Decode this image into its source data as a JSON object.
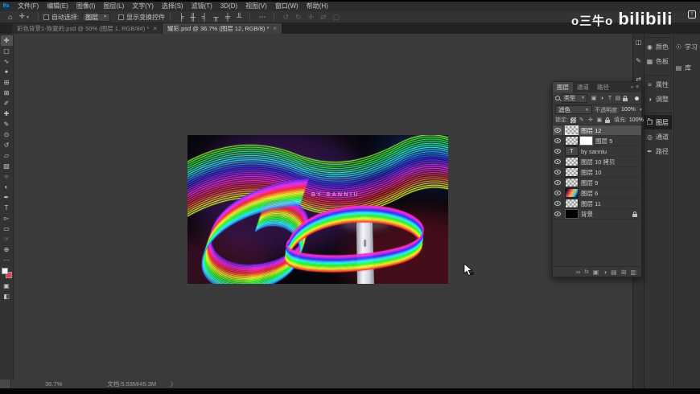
{
  "watermark": {
    "uploader": "o三牛o",
    "platform": "bilibili",
    "share_glyph": "↑"
  },
  "app": {
    "icon_label": "Ps"
  },
  "menu_bar": {
    "items": [
      "文件(F)",
      "编辑(E)",
      "图像(I)",
      "图层(L)",
      "文字(Y)",
      "选择(S)",
      "滤镜(T)",
      "3D(D)",
      "视图(V)",
      "窗口(W)",
      "帮助(H)"
    ]
  },
  "options_bar": {
    "home_glyph": "⌂",
    "move_glyph": "✛",
    "auto_select_label": "自动选择:",
    "auto_select_value": "图层",
    "show_transform_label": "显示变换控件",
    "align_icons": [
      {
        "name": "align-left-icon",
        "glyph": "╞"
      },
      {
        "name": "align-center-icon",
        "glyph": "╫"
      },
      {
        "name": "align-right-icon",
        "glyph": "╡"
      },
      {
        "name": "align-top-icon",
        "glyph": "╥"
      },
      {
        "name": "align-middle-icon",
        "glyph": "╪"
      },
      {
        "name": "align-bottom-icon",
        "glyph": "╨"
      }
    ],
    "more_glyph": "⋯",
    "threed_icons": [
      {
        "name": "3d-rotate-icon",
        "glyph": "↺"
      },
      {
        "name": "3d-roll-icon",
        "glyph": "↻"
      },
      {
        "name": "3d-drag-icon",
        "glyph": "✛"
      },
      {
        "name": "3d-slide-icon",
        "glyph": "⇄"
      },
      {
        "name": "3d-scale-icon",
        "glyph": "▢"
      }
    ]
  },
  "document_tabs": [
    {
      "title": "彩色背景1-恢复的.psd @ 50% (图层 1, RGB/8#) *",
      "close_glyph": "×",
      "active": false
    },
    {
      "title": "耀彩.psd @ 36.7% (图层 12, RGB/8) *",
      "close_glyph": "×",
      "active": true
    }
  ],
  "tools": [
    {
      "name": "move-tool",
      "glyph": "✛",
      "active": true
    },
    {
      "name": "marquee-tool",
      "glyph": "▢"
    },
    {
      "name": "lasso-tool",
      "glyph": "∿"
    },
    {
      "name": "magic-wand-tool",
      "glyph": "✦"
    },
    {
      "name": "crop-tool",
      "glyph": "⊞"
    },
    {
      "name": "frame-tool",
      "glyph": "⊠"
    },
    {
      "name": "eyedropper-tool",
      "glyph": "✐"
    },
    {
      "name": "healing-brush-tool",
      "glyph": "✚"
    },
    {
      "name": "brush-tool",
      "glyph": "✎"
    },
    {
      "name": "clone-stamp-tool",
      "glyph": "⊙"
    },
    {
      "name": "history-brush-tool",
      "glyph": "↺"
    },
    {
      "name": "eraser-tool",
      "glyph": "▱"
    },
    {
      "name": "gradient-tool",
      "glyph": "▨"
    },
    {
      "name": "blur-tool",
      "glyph": "○"
    },
    {
      "name": "dodge-tool",
      "glyph": "◐"
    },
    {
      "name": "pen-tool",
      "glyph": "✒"
    },
    {
      "name": "type-tool",
      "glyph": "T"
    },
    {
      "name": "path-select-tool",
      "glyph": "▻"
    },
    {
      "name": "shape-tool",
      "glyph": "▭"
    },
    {
      "name": "hand-tool",
      "glyph": "☞"
    },
    {
      "name": "zoom-tool",
      "glyph": "⊕"
    },
    {
      "name": "toolbar-more",
      "glyph": "⋯"
    }
  ],
  "toolbar_bottom": [
    {
      "name": "quick-mask-icon",
      "glyph": "▣"
    },
    {
      "name": "screen-mode-icon",
      "glyph": "◧"
    }
  ],
  "artwork": {
    "credit_text": "BY SANNIU"
  },
  "layers_panel": {
    "tabs": [
      {
        "label": "图层",
        "active": true
      },
      {
        "label": "通道",
        "active": false
      },
      {
        "label": "路径",
        "active": false
      }
    ],
    "tabs_more_glyph": "»",
    "tabs_menu_glyph": "≡",
    "filter_type_label": "类型",
    "filter_icons": [
      {
        "name": "filter-pixel-layers-icon",
        "glyph": "▣"
      },
      {
        "name": "filter-adjustment-layers-icon",
        "glyph": "◑"
      },
      {
        "name": "filter-type-layers-icon",
        "glyph": "T"
      },
      {
        "name": "filter-shape-layers-icon",
        "glyph": "▤"
      },
      {
        "name": "filter-smart-objects-icon",
        "type": "lock"
      }
    ],
    "blend_mode": "滤色",
    "opacity_label": "不透明度:",
    "opacity_value": "100%",
    "lock_label": "锁定:",
    "lock_icons": [
      {
        "name": "lock-transparent-icon",
        "type": "checker"
      },
      {
        "name": "lock-pixels-icon",
        "glyph": "✎"
      },
      {
        "name": "lock-position-icon",
        "glyph": "✛"
      },
      {
        "name": "lock-artboard-icon",
        "glyph": "▣"
      },
      {
        "name": "lock-all-icon",
        "type": "lock"
      }
    ],
    "fill_label": "填充:",
    "fill_value": "100%",
    "layers": [
      {
        "name": "图层 12",
        "thumb": "checker",
        "selected": true
      },
      {
        "name": "图层 5",
        "thumb": "checker",
        "mask": true
      },
      {
        "name": "by sanniu",
        "thumb": "text"
      },
      {
        "name": "图层 10 拷贝",
        "thumb": "checker"
      },
      {
        "name": "图层 10",
        "thumb": "checker"
      },
      {
        "name": "图层 9",
        "thumb": "checker"
      },
      {
        "name": "图层 6",
        "thumb": "art"
      },
      {
        "name": "图层 11",
        "thumb": "checker"
      },
      {
        "name": "背景",
        "thumb": "black",
        "locked": true
      }
    ],
    "text_thumb_glyph": "T",
    "bottom_icons": [
      {
        "name": "link-layers-icon",
        "glyph": "∞"
      },
      {
        "name": "layer-style-icon",
        "glyph": "fx"
      },
      {
        "name": "add-mask-icon",
        "glyph": "▣"
      },
      {
        "name": "adjustment-layer-icon",
        "glyph": "◑"
      },
      {
        "name": "new-group-icon",
        "glyph": "▤"
      },
      {
        "name": "new-layer-icon",
        "glyph": "⊞"
      },
      {
        "name": "delete-layer-icon",
        "glyph": "▥"
      }
    ]
  },
  "right_dock": {
    "collapsed_icons": [
      {
        "name": "collapsed-panel-icon-1",
        "glyph": "◫"
      },
      {
        "name": "collapsed-panel-icon-2",
        "glyph": "✎"
      },
      {
        "name": "collapsed-panel-icon-3",
        "glyph": "⇄"
      }
    ],
    "groups": [
      [
        {
          "label": "颜色",
          "glyph": "◉"
        },
        {
          "label": "色板",
          "glyph": "▦"
        }
      ],
      [
        {
          "label": "属性",
          "glyph": "≡"
        },
        {
          "label": "调整",
          "glyph": "◑"
        }
      ],
      [
        {
          "label": "图层",
          "glyph": "❐",
          "active": true
        },
        {
          "label": "通道",
          "glyph": "◎"
        },
        {
          "label": "路径",
          "glyph": "✒"
        }
      ]
    ],
    "far": [
      {
        "label": "学习",
        "glyph": "☉"
      },
      {
        "label": "库",
        "glyph": "▤"
      }
    ]
  },
  "status_bar": {
    "zoom_value": "36.7%",
    "doc_label": "文档:5.53M/45.3M",
    "expand_glyph": "〉"
  }
}
